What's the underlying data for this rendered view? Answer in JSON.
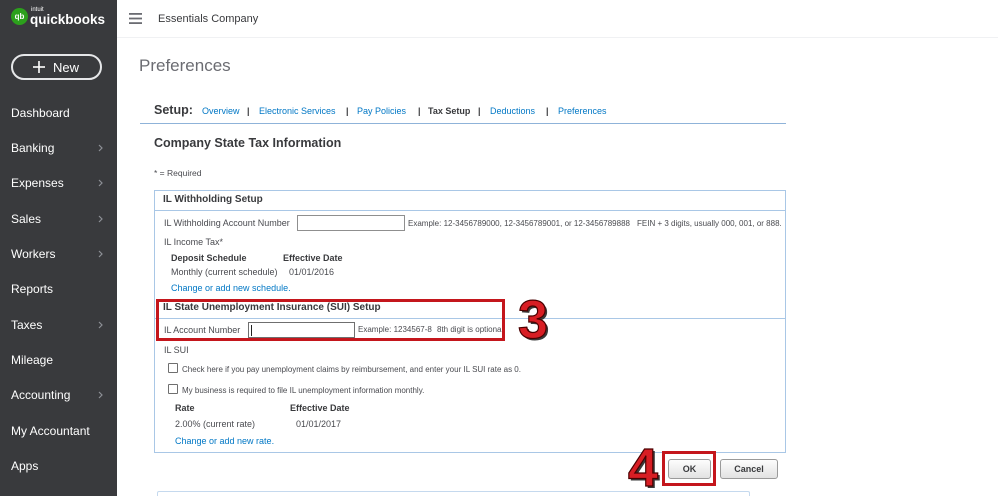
{
  "colors": {
    "sidebar_bg": "#393a3d",
    "brand_green": "#2ca01c",
    "link": "#0077c5",
    "box_border": "#a9c7e6",
    "annotation_red": "#c4161c"
  },
  "app": {
    "logo": {
      "icon": "quickbooks-logo-icon",
      "badge": "qb",
      "brand_small": "intuit",
      "brand_main": "quickbooks"
    }
  },
  "sidebar": {
    "new_button": {
      "icon": "plus-icon",
      "label": "New"
    },
    "items": [
      {
        "label": "Dashboard",
        "has_submenu": false
      },
      {
        "label": "Banking",
        "has_submenu": true
      },
      {
        "label": "Expenses",
        "has_submenu": true
      },
      {
        "label": "Sales",
        "has_submenu": true
      },
      {
        "label": "Workers",
        "has_submenu": true
      },
      {
        "label": "Reports",
        "has_submenu": false
      },
      {
        "label": "Taxes",
        "has_submenu": true
      },
      {
        "label": "Mileage",
        "has_submenu": false
      },
      {
        "label": "Accounting",
        "has_submenu": true
      },
      {
        "label": "My Accountant",
        "has_submenu": false
      },
      {
        "label": "Apps",
        "has_submenu": false
      }
    ]
  },
  "topbar": {
    "menu_icon": "hamburger-icon",
    "company_name": "Essentials Company"
  },
  "page": {
    "title": "Preferences"
  },
  "setup_nav": {
    "label": "Setup:",
    "separator": "|",
    "links": [
      {
        "label": "Overview",
        "active": false
      },
      {
        "label": "Electronic Services",
        "active": false
      },
      {
        "label": "Pay Policies",
        "active": false
      },
      {
        "label": "Tax Setup",
        "active": true
      },
      {
        "label": "Deductions",
        "active": false
      },
      {
        "label": "Preferences",
        "active": false
      }
    ]
  },
  "form": {
    "title": "Company State Tax Information",
    "required_note": "* = Required",
    "withholding": {
      "header": "IL Withholding Setup",
      "account": {
        "label": "IL Withholding Account Number",
        "value": "",
        "example": "Example: 12-3456789000, 12-3456789001, or 12-3456789888",
        "note": "FEIN + 3 digits, usually 000, 001, or 888."
      },
      "income_tax_label": "IL Income Tax*",
      "schedule_table": {
        "columns": [
          "Deposit Schedule",
          "Effective Date"
        ],
        "rows": [
          [
            "Monthly (current schedule)",
            "01/01/2016"
          ]
        ]
      },
      "change_link": "Change or add new schedule."
    },
    "sui": {
      "header": "IL State Unemployment Insurance (SUI) Setup",
      "account": {
        "label": "IL Account Number",
        "value": "",
        "focused": true,
        "example": "Example: 1234567-8",
        "note": "8th digit is optional."
      },
      "section_label": "IL SUI",
      "checkboxes": [
        {
          "label": "Check here if you pay unemployment claims by reimbursement, and enter your IL SUI rate as 0.",
          "checked": false
        },
        {
          "label": "My business is required to file IL unemployment information monthly.",
          "checked": false
        }
      ],
      "rate_table": {
        "columns": [
          "Rate",
          "Effective Date"
        ],
        "rows": [
          [
            "2.00% (current rate)",
            "01/01/2017"
          ]
        ]
      },
      "change_link": "Change or add new rate."
    },
    "buttons": {
      "ok": "OK",
      "cancel": "Cancel"
    }
  },
  "annotations": [
    {
      "label": "3"
    },
    {
      "label": "4"
    }
  ]
}
